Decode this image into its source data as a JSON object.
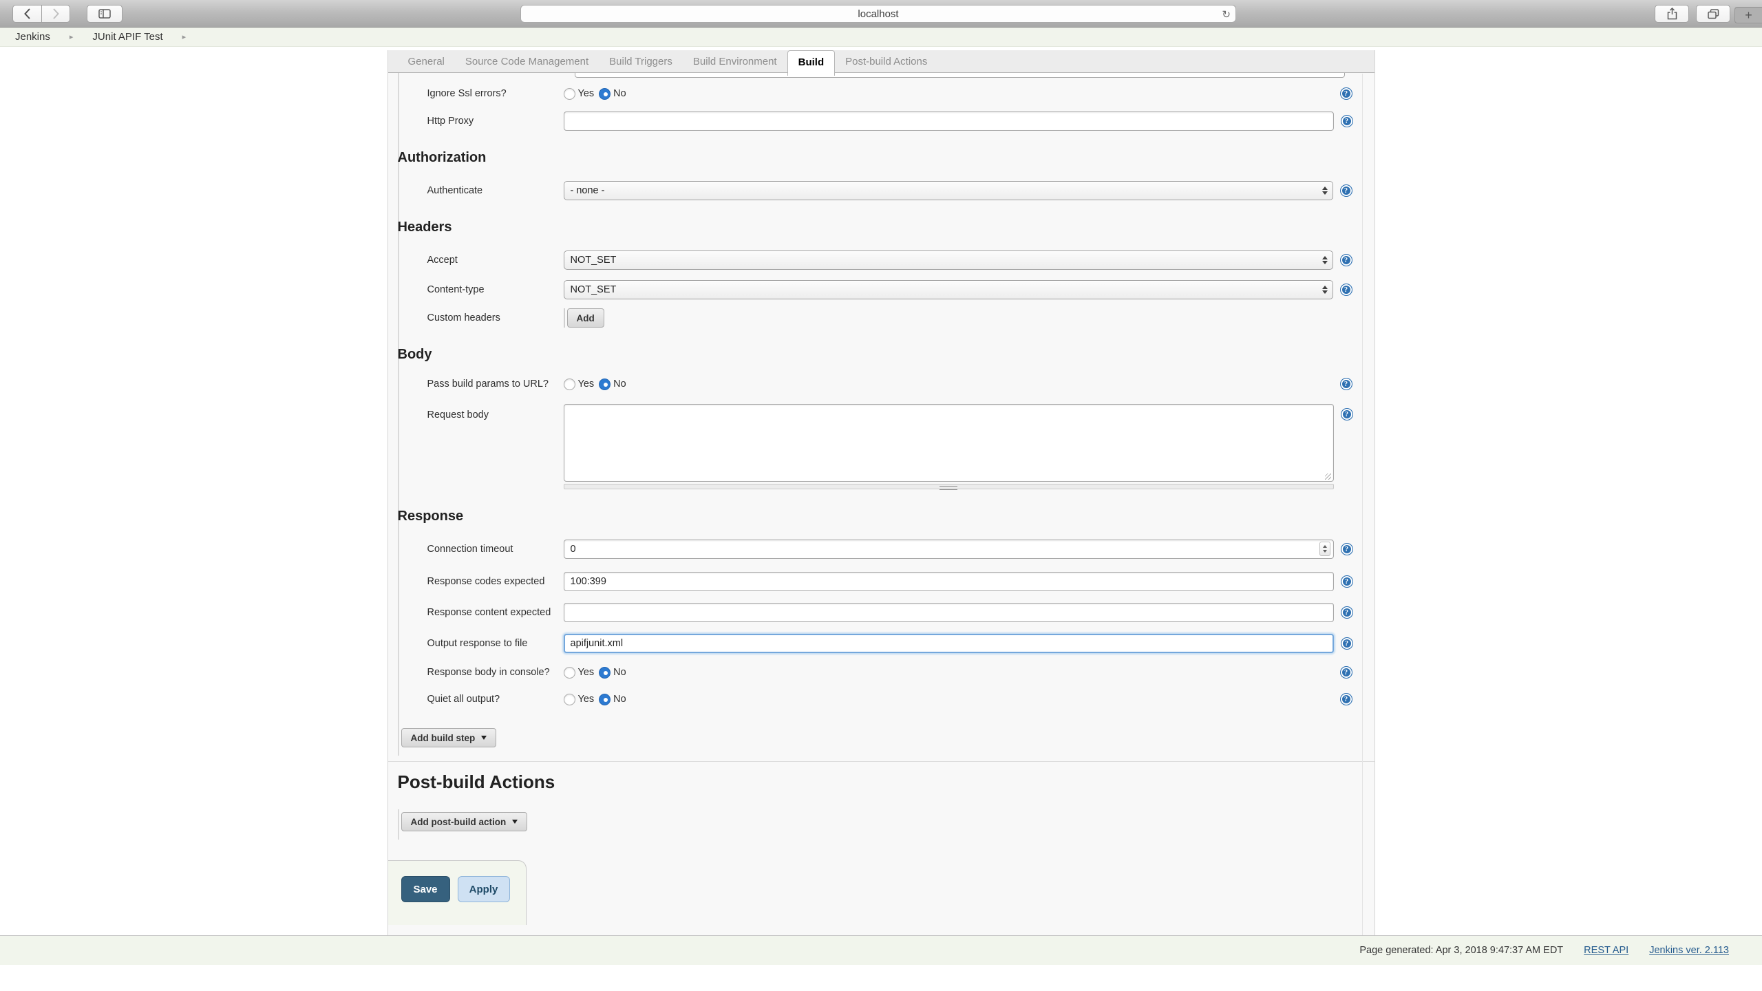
{
  "browser": {
    "url": "localhost",
    "reload_glyph": "↻",
    "newtab_glyph": "+"
  },
  "breadcrumb": {
    "items": [
      "Jenkins",
      "JUnit APIF Test"
    ],
    "sep_glyph": "▸"
  },
  "tabs": [
    {
      "label": "General"
    },
    {
      "label": "Source Code Management"
    },
    {
      "label": "Build Triggers"
    },
    {
      "label": "Build Environment"
    },
    {
      "label": "Build",
      "active": true
    },
    {
      "label": "Post-build Actions"
    }
  ],
  "form": {
    "help_glyph": "?",
    "yes_label": "Yes",
    "no_label": "No",
    "ignore_ssl": {
      "label": "Ignore Ssl errors?",
      "selected": "No"
    },
    "http_proxy": {
      "label": "Http Proxy",
      "value": ""
    },
    "section_authorization": "Authorization",
    "authenticate": {
      "label": "Authenticate",
      "value": "- none -"
    },
    "section_headers": "Headers",
    "accept": {
      "label": "Accept",
      "value": "NOT_SET"
    },
    "content_type": {
      "label": "Content-type",
      "value": "NOT_SET"
    },
    "custom_headers": {
      "label": "Custom headers",
      "button": "Add"
    },
    "section_body": "Body",
    "pass_build_params": {
      "label": "Pass build params to URL?",
      "selected": "No"
    },
    "request_body": {
      "label": "Request body",
      "value": ""
    },
    "section_response": "Response",
    "connection_timeout": {
      "label": "Connection timeout",
      "value": "0"
    },
    "response_codes": {
      "label": "Response codes expected",
      "value": "100:399"
    },
    "response_content": {
      "label": "Response content expected",
      "value": ""
    },
    "output_response": {
      "label": "Output response to file",
      "value": "apifjunit.xml"
    },
    "response_body_console": {
      "label": "Response body in console?",
      "selected": "No"
    },
    "quiet_output": {
      "label": "Quiet all output?",
      "selected": "No"
    },
    "add_build_step_label": "Add build step",
    "post_build_heading": "Post-build Actions",
    "add_post_build_label": "Add post-build action",
    "save_label": "Save",
    "apply_label": "Apply"
  },
  "footer": {
    "generated": "Page generated: Apr 3, 2018 9:47:37 AM EDT",
    "rest_api": "REST API",
    "version": "Jenkins ver. 2.113"
  },
  "colors": {
    "radio_selected": "#2d7ad1",
    "help_icon": "#2f71b2",
    "save_bg": "#36617e",
    "apply_bg": "#cfe1f3",
    "link": "#255b8e",
    "breadcrumb_bg": "#f1f4ec",
    "footer_bg": "#f1f5ec",
    "panel_bg": "#f8f8f8",
    "tabbar_bg": "#ececec"
  }
}
